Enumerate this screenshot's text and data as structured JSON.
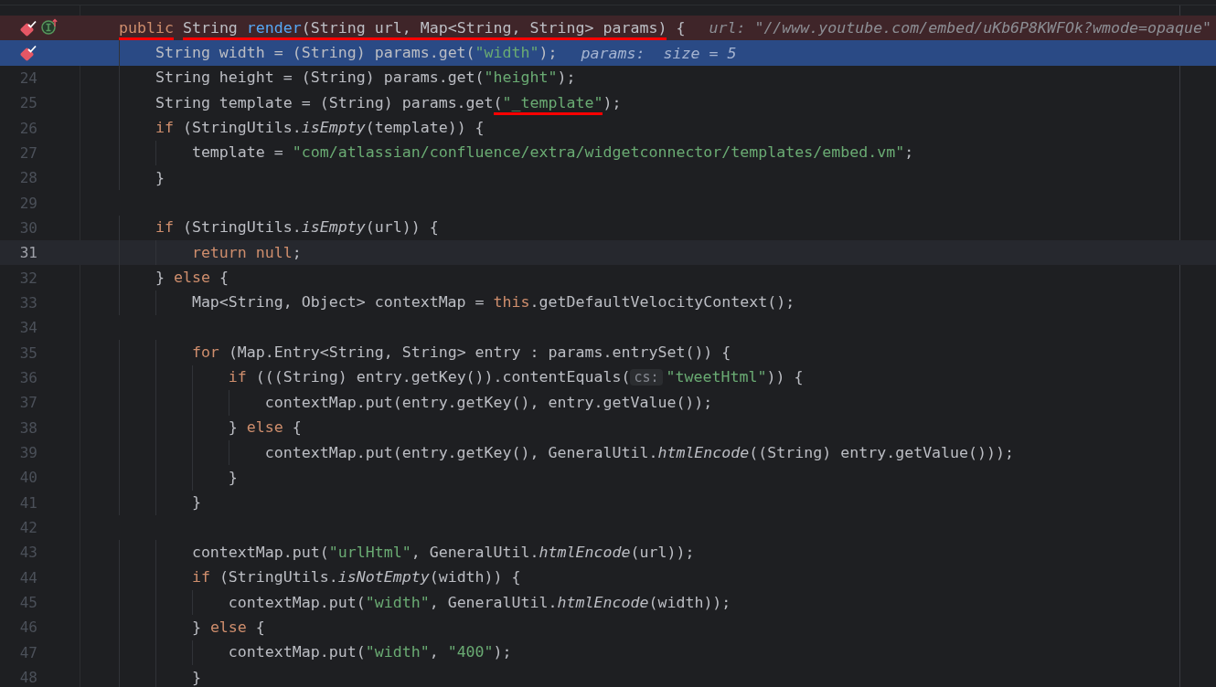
{
  "editor": {
    "lines": [
      {
        "kind": "breakpoint_line",
        "breakpoint": true,
        "implements_marker": true,
        "tokens": [
          {
            "kind": "keyword",
            "text": "    public",
            "underlined": true
          },
          {
            "kind": "plain",
            "text": " String ",
            "underlined": true
          },
          {
            "kind": "declaration",
            "text": "render",
            "underlined": true
          },
          {
            "kind": "plain",
            "text": "(String url, Map<String, String> params)",
            "underlined": true
          },
          {
            "kind": "plain",
            "text": " {",
            "underlined": false
          }
        ],
        "debug_hint": "url: \"//www.youtube.com/embed/uKb6P8KWFOk?wmode=opaque\""
      },
      {
        "kind": "execution_point",
        "breakpoint": true,
        "implements_marker": false,
        "tokens": [
          {
            "kind": "plain",
            "text": "        String width = (String) params.get(",
            "underlined": false
          },
          {
            "kind": "string",
            "text": "\"width\"",
            "underlined": false
          },
          {
            "kind": "plain",
            "text": ");",
            "underlined": false
          }
        ],
        "debug_hint": "params:  size = 5"
      },
      {
        "number": "24",
        "kind": "normal",
        "breakpoint": false,
        "implements_marker": false,
        "tokens": [
          {
            "kind": "plain",
            "text": "        String height = (String) params.get(",
            "underlined": false
          },
          {
            "kind": "string",
            "text": "\"height\"",
            "underlined": false
          },
          {
            "kind": "plain",
            "text": ");",
            "underlined": false
          }
        ]
      },
      {
        "number": "25",
        "kind": "normal",
        "breakpoint": false,
        "implements_marker": false,
        "tokens": [
          {
            "kind": "plain",
            "text": "        String template = (String) params.get",
            "underlined": false
          },
          {
            "kind": "plain",
            "text": "(",
            "underlined": true
          },
          {
            "kind": "string",
            "text": "\"_template\"",
            "underlined": true
          },
          {
            "kind": "plain",
            "text": ");",
            "underlined": false
          }
        ]
      },
      {
        "number": "26",
        "kind": "normal",
        "breakpoint": false,
        "implements_marker": false,
        "tokens": [
          {
            "kind": "keyword",
            "text": "        if",
            "underlined": false
          },
          {
            "kind": "plain",
            "text": " (StringUtils.",
            "underlined": false
          },
          {
            "kind": "static",
            "text": "isEmpty",
            "underlined": false
          },
          {
            "kind": "plain",
            "text": "(template)) {",
            "underlined": false
          }
        ]
      },
      {
        "number": "27",
        "kind": "normal",
        "breakpoint": false,
        "implements_marker": false,
        "tokens": [
          {
            "kind": "plain",
            "text": "            template = ",
            "underlined": false
          },
          {
            "kind": "string",
            "text": "\"com/atlassian/confluence/extra/widgetconnector/templates/embed.vm\"",
            "underlined": false
          },
          {
            "kind": "plain",
            "text": ";",
            "underlined": false
          }
        ]
      },
      {
        "number": "28",
        "kind": "normal",
        "breakpoint": false,
        "implements_marker": false,
        "tokens": [
          {
            "kind": "plain",
            "text": "        }",
            "underlined": false
          }
        ]
      },
      {
        "number": "29",
        "kind": "normal",
        "breakpoint": false,
        "implements_marker": false
      },
      {
        "number": "30",
        "kind": "normal",
        "breakpoint": false,
        "implements_marker": false,
        "tokens": [
          {
            "kind": "keyword",
            "text": "        if",
            "underlined": false
          },
          {
            "kind": "plain",
            "text": " (StringUtils.",
            "underlined": false
          },
          {
            "kind": "static",
            "text": "isEmpty",
            "underlined": false
          },
          {
            "kind": "plain",
            "text": "(url)) {",
            "underlined": false
          }
        ]
      },
      {
        "number": "31",
        "kind": "caret_line",
        "breakpoint": false,
        "implements_marker": false,
        "tokens": [
          {
            "kind": "keyword",
            "text": "            return null",
            "underlined": false
          },
          {
            "kind": "plain",
            "text": ";",
            "underlined": false
          }
        ]
      },
      {
        "number": "32",
        "kind": "normal",
        "breakpoint": false,
        "implements_marker": false,
        "tokens": [
          {
            "kind": "plain",
            "text": "        } ",
            "underlined": false
          },
          {
            "kind": "keyword",
            "text": "else",
            "underlined": false
          },
          {
            "kind": "plain",
            "text": " {",
            "underlined": false
          }
        ]
      },
      {
        "number": "33",
        "kind": "normal",
        "breakpoint": false,
        "implements_marker": false,
        "tokens": [
          {
            "kind": "plain",
            "text": "            Map<String, Object> contextMap = ",
            "underlined": false
          },
          {
            "kind": "keyword",
            "text": "this",
            "underlined": false
          },
          {
            "kind": "plain",
            "text": ".getDefaultVelocityContext();",
            "underlined": false
          }
        ]
      },
      {
        "number": "34",
        "kind": "normal",
        "breakpoint": false,
        "implements_marker": false
      },
      {
        "number": "35",
        "kind": "normal",
        "breakpoint": false,
        "implements_marker": false,
        "tokens": [
          {
            "kind": "keyword",
            "text": "            for",
            "underlined": false
          },
          {
            "kind": "plain",
            "text": " (Map.Entry<String, String> entry : params.entrySet()) {",
            "underlined": false
          }
        ]
      },
      {
        "number": "36",
        "kind": "normal",
        "breakpoint": false,
        "implements_marker": false,
        "tokens": [
          {
            "kind": "keyword",
            "text": "                if",
            "underlined": false
          },
          {
            "kind": "plain",
            "text": " (((String) entry.getKey()).contentEquals(",
            "underlined": false
          },
          {
            "kind": "param_hint",
            "text": "cs:",
            "underlined": false
          },
          {
            "kind": "string",
            "text": "\"tweetHtml\"",
            "underlined": false
          },
          {
            "kind": "plain",
            "text": ")) {",
            "underlined": false
          }
        ]
      },
      {
        "number": "37",
        "kind": "normal",
        "breakpoint": false,
        "implements_marker": false,
        "tokens": [
          {
            "kind": "plain",
            "text": "                    contextMap.put(entry.getKey(), entry.getValue());",
            "underlined": false
          }
        ]
      },
      {
        "number": "38",
        "kind": "normal",
        "breakpoint": false,
        "implements_marker": false,
        "tokens": [
          {
            "kind": "plain",
            "text": "                } ",
            "underlined": false
          },
          {
            "kind": "keyword",
            "text": "else",
            "underlined": false
          },
          {
            "kind": "plain",
            "text": " {",
            "underlined": false
          }
        ]
      },
      {
        "number": "39",
        "kind": "normal",
        "breakpoint": false,
        "implements_marker": false,
        "tokens": [
          {
            "kind": "plain",
            "text": "                    contextMap.put(entry.getKey(), GeneralUtil.",
            "underlined": false
          },
          {
            "kind": "static",
            "text": "htmlEncode",
            "underlined": false
          },
          {
            "kind": "plain",
            "text": "((String) entry.getValue()));",
            "underlined": false
          }
        ]
      },
      {
        "number": "40",
        "kind": "normal",
        "breakpoint": false,
        "implements_marker": false,
        "tokens": [
          {
            "kind": "plain",
            "text": "                }",
            "underlined": false
          }
        ]
      },
      {
        "number": "41",
        "kind": "normal",
        "breakpoint": false,
        "implements_marker": false,
        "tokens": [
          {
            "kind": "plain",
            "text": "            }",
            "underlined": false
          }
        ]
      },
      {
        "number": "42",
        "kind": "normal",
        "breakpoint": false,
        "implements_marker": false
      },
      {
        "number": "43",
        "kind": "normal",
        "breakpoint": false,
        "implements_marker": false,
        "tokens": [
          {
            "kind": "plain",
            "text": "            contextMap.put(",
            "underlined": false
          },
          {
            "kind": "string",
            "text": "\"urlHtml\"",
            "underlined": false
          },
          {
            "kind": "plain",
            "text": ", GeneralUtil.",
            "underlined": false
          },
          {
            "kind": "static",
            "text": "htmlEncode",
            "underlined": false
          },
          {
            "kind": "plain",
            "text": "(url));",
            "underlined": false
          }
        ]
      },
      {
        "number": "44",
        "kind": "normal",
        "breakpoint": false,
        "implements_marker": false,
        "tokens": [
          {
            "kind": "keyword",
            "text": "            if",
            "underlined": false
          },
          {
            "kind": "plain",
            "text": " (StringUtils.",
            "underlined": false
          },
          {
            "kind": "static",
            "text": "isNotEmpty",
            "underlined": false
          },
          {
            "kind": "plain",
            "text": "(width)) {",
            "underlined": false
          }
        ]
      },
      {
        "number": "45",
        "kind": "normal",
        "breakpoint": false,
        "implements_marker": false,
        "tokens": [
          {
            "kind": "plain",
            "text": "                contextMap.put(",
            "underlined": false
          },
          {
            "kind": "string",
            "text": "\"width\"",
            "underlined": false
          },
          {
            "kind": "plain",
            "text": ", GeneralUtil.",
            "underlined": false
          },
          {
            "kind": "static",
            "text": "htmlEncode",
            "underlined": false
          },
          {
            "kind": "plain",
            "text": "(width));",
            "underlined": false
          }
        ]
      },
      {
        "number": "46",
        "kind": "normal",
        "breakpoint": false,
        "implements_marker": false,
        "tokens": [
          {
            "kind": "plain",
            "text": "            } ",
            "underlined": false
          },
          {
            "kind": "keyword",
            "text": "else",
            "underlined": false
          },
          {
            "kind": "plain",
            "text": " {",
            "underlined": false
          }
        ]
      },
      {
        "number": "47",
        "kind": "normal",
        "breakpoint": false,
        "implements_marker": false,
        "tokens": [
          {
            "kind": "plain",
            "text": "                contextMap.put(",
            "underlined": false
          },
          {
            "kind": "string",
            "text": "\"width\"",
            "underlined": false
          },
          {
            "kind": "plain",
            "text": ", ",
            "underlined": false
          },
          {
            "kind": "string",
            "text": "\"400\"",
            "underlined": false
          },
          {
            "kind": "plain",
            "text": ");",
            "underlined": false
          }
        ]
      },
      {
        "number": "48",
        "kind": "normal",
        "breakpoint": false,
        "implements_marker": false,
        "tokens": [
          {
            "kind": "plain",
            "text": "            }"
          }
        ]
      }
    ]
  }
}
